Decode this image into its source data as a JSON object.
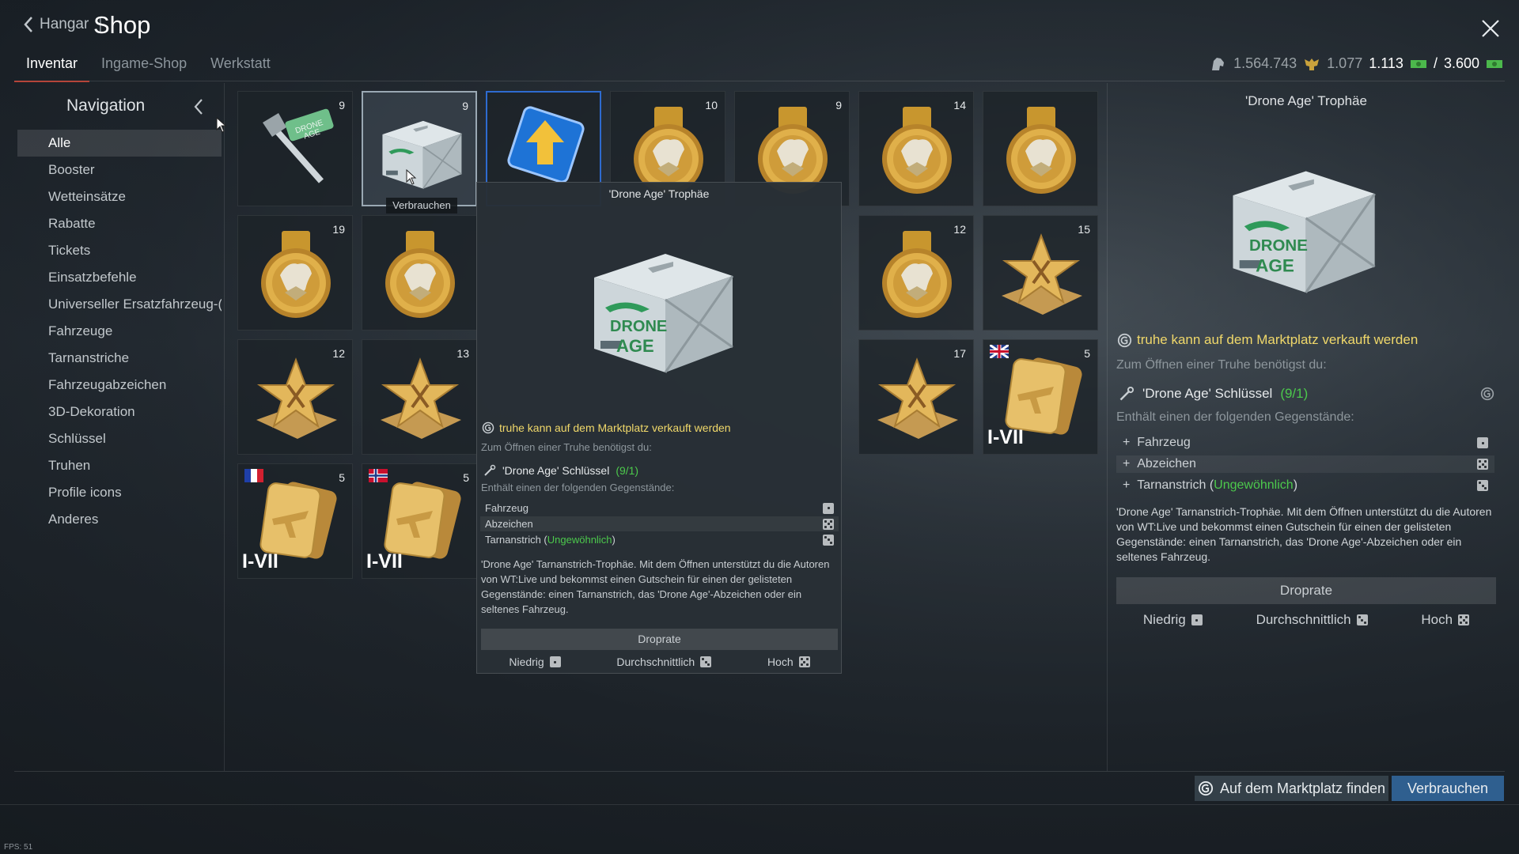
{
  "header": {
    "back_label": "Hangar",
    "separator": "|",
    "title": "Shop",
    "tabs": [
      {
        "label": "Inventar",
        "active": true
      },
      {
        "label": "Ingame-Shop",
        "active": false
      },
      {
        "label": "Werkstatt",
        "active": false
      }
    ],
    "currency": {
      "silver_lions": "1.564.743",
      "eagles": "1.077",
      "ge_current": "1.113",
      "ge_separator": "/",
      "ge_total": "3.600"
    }
  },
  "navigation": {
    "title": "Navigation",
    "items": [
      {
        "label": "Alle",
        "active": true
      },
      {
        "label": "Booster"
      },
      {
        "label": "Wetteinsätze"
      },
      {
        "label": "Rabatte"
      },
      {
        "label": "Tickets"
      },
      {
        "label": "Einsatzbefehle"
      },
      {
        "label": "Universeller Ersatzfahrzeug-("
      },
      {
        "label": "Fahrzeuge"
      },
      {
        "label": "Tarnanstriche"
      },
      {
        "label": "Fahrzeugabzeichen"
      },
      {
        "label": "3D-Dekoration"
      },
      {
        "label": "Schlüssel"
      },
      {
        "label": "Truhen"
      },
      {
        "label": "Profile icons"
      },
      {
        "label": "Anderes"
      }
    ]
  },
  "inventory": {
    "items": [
      {
        "icon": "key-icon",
        "count": "9"
      },
      {
        "icon": "chest-icon",
        "count": "9",
        "selected": true
      },
      {
        "icon": "upgrade-arrow-icon",
        "count": ""
      },
      {
        "icon": "medal-icon",
        "count": "10"
      },
      {
        "icon": "medal-icon",
        "count": "9"
      },
      {
        "icon": "medal-icon",
        "count": "14"
      },
      {
        "icon": "medal-icon",
        "count": ""
      },
      {
        "icon": "medal-icon",
        "count": "19"
      },
      {
        "icon": "medal-icon",
        "count": ""
      },
      {
        "icon": "medal-icon",
        "count": "12"
      },
      {
        "icon": "star-award-icon",
        "count": "15"
      },
      {
        "icon": "star-award-icon",
        "count": "12"
      },
      {
        "icon": "star-award-icon",
        "count": "13"
      },
      {
        "icon": "star-award-icon",
        "count": "17"
      },
      {
        "icon": "vehicle-card-icon",
        "count": "5",
        "tier": "I-VII",
        "flag": "uk"
      },
      {
        "icon": "vehicle-card-icon",
        "count": "5",
        "tier": "I-VII",
        "flag": "france"
      },
      {
        "icon": "vehicle-card-icon",
        "count": "5",
        "tier": "I-VII",
        "flag": "norway"
      }
    ],
    "hover_tooltip": "Verbrauchen"
  },
  "popup": {
    "title": "'Drone Age' Trophäe",
    "market_text": "truhe kann auf dem Marktplatz verkauft werden",
    "needs_text": "Zum Öffnen einer Truhe benötigst du:",
    "key_name": "'Drone Age' Schlüssel",
    "key_count": "(9/1)",
    "contains_text": "Enthält einen der folgenden Gegenstände:",
    "contents": [
      {
        "label": "Fahrzeug"
      },
      {
        "label": "Abzeichen"
      },
      {
        "label": "Tarnanstrich",
        "rarity": "Ungewöhnlich"
      }
    ],
    "description": "'Drone Age' Tarnanstrich-Trophäe. Mit dem Öffnen unterstützt du die Autoren von WT:Live und bekommst einen Gutschein für einen der gelisteten Gegenstände: einen Tarnanstrich, das 'Drone Age'-Abzeichen oder ein seltenes Fahrzeug.",
    "droprate_label": "Droprate",
    "droprate_levels": [
      "Niedrig",
      "Durchschnittlich",
      "Hoch"
    ]
  },
  "detail_panel": {
    "title": "'Drone Age' Trophäe",
    "market_text": "truhe kann auf dem Marktplatz verkauft werden",
    "needs_text": "Zum Öffnen einer Truhe benötigst du:",
    "key_name": "'Drone Age' Schlüssel",
    "key_count": "(9/1)",
    "contains_text": "Enthält einen der folgenden Gegenstände:",
    "contents": [
      {
        "label": "Fahrzeug",
        "prefix": "+"
      },
      {
        "label": "Abzeichen",
        "prefix": "+"
      },
      {
        "label": "Tarnanstrich",
        "rarity": "Ungewöhnlich",
        "prefix": "+"
      }
    ],
    "description": "'Drone Age' Tarnanstrich-Trophäe. Mit dem Öffnen unterstützt du die Autoren von WT:Live und bekommst einen Gutschein für einen der gelisteten Gegenstände: einen Tarnanstrich, das 'Drone Age'-Abzeichen oder ein seltenes Fahrzeug.",
    "droprate_label": "Droprate",
    "droprate_levels": [
      "Niedrig",
      "Durchschnittlich",
      "Hoch"
    ]
  },
  "chest_art": {
    "line1": "DRONE",
    "line2": "AGE"
  },
  "key_art": {
    "line1": "DRONE",
    "line2": "AGE"
  },
  "actions": {
    "market_button": "Auf dem Marktplatz finden",
    "use_button": "Verbrauchen"
  },
  "fps": "FPS: 51",
  "colors": {
    "accent_red": "#b03a2e",
    "use_button": "#2f5f8f",
    "market_yellow": "#f0d86a",
    "rarity_green": "#4cc94c",
    "selected_blue": "#2e6bd0"
  }
}
